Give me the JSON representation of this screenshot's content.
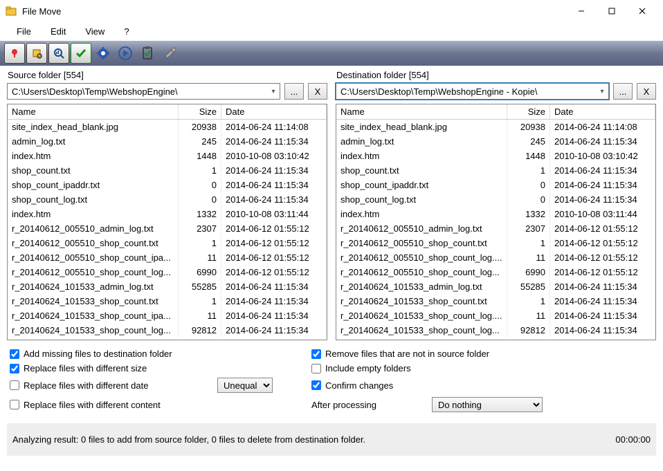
{
  "window": {
    "title": "File Move"
  },
  "menu": {
    "file": "File",
    "edit": "Edit",
    "view": "View",
    "help": "?"
  },
  "source": {
    "label": "Source folder [554]",
    "path": "C:\\Users\\Desktop\\Temp\\WebshopEngine\\",
    "browse": "...",
    "clear": "X"
  },
  "dest": {
    "label": "Destination folder [554]",
    "path": "C:\\Users\\Desktop\\Temp\\WebshopEngine - Kopie\\",
    "browse": "...",
    "clear": "X"
  },
  "columns": {
    "name": "Name",
    "size": "Size",
    "date": "Date"
  },
  "files": [
    {
      "name": "site_index_head_blank.jpg",
      "size": "20938",
      "date": "2014-06-24 11:14:08"
    },
    {
      "name": "admin_log.txt",
      "size": "245",
      "date": "2014-06-24 11:15:34"
    },
    {
      "name": "index.htm",
      "size": "1448",
      "date": "2010-10-08 03:10:42"
    },
    {
      "name": "shop_count.txt",
      "size": "1",
      "date": "2014-06-24 11:15:34"
    },
    {
      "name": "shop_count_ipaddr.txt",
      "size": "0",
      "date": "2014-06-24 11:15:34"
    },
    {
      "name": "shop_count_log.txt",
      "size": "0",
      "date": "2014-06-24 11:15:34"
    },
    {
      "name": "index.htm",
      "size": "1332",
      "date": "2010-10-08 03:11:44"
    },
    {
      "name": "r_20140612_005510_admin_log.txt",
      "size": "2307",
      "date": "2014-06-12 01:55:12"
    },
    {
      "name": "r_20140612_005510_shop_count.txt",
      "size": "1",
      "date": "2014-06-12 01:55:12"
    },
    {
      "name": "r_20140612_005510_shop_count_ipa...",
      "size": "11",
      "date": "2014-06-12 01:55:12"
    },
    {
      "name": "r_20140612_005510_shop_count_log...",
      "size": "6990",
      "date": "2014-06-12 01:55:12"
    },
    {
      "name": "r_20140624_101533_admin_log.txt",
      "size": "55285",
      "date": "2014-06-24 11:15:34"
    },
    {
      "name": "r_20140624_101533_shop_count.txt",
      "size": "1",
      "date": "2014-06-24 11:15:34"
    },
    {
      "name": "r_20140624_101533_shop_count_ipa...",
      "size": "11",
      "date": "2014-06-24 11:15:34"
    },
    {
      "name": "r_20140624_101533_shop_count_log...",
      "size": "92812",
      "date": "2014-06-24 11:15:34"
    }
  ],
  "dest_files_diff": {
    "9": "r_20140612_005510_shop_count_log....",
    "13": "r_20140624_101533_shop_count_log...."
  },
  "options": {
    "add_missing": "Add missing files to destination folder",
    "replace_size": "Replace files with different size",
    "replace_date": "Replace files with different date",
    "replace_content": "Replace files with different content",
    "date_mode": "Unequal",
    "remove_extra": "Remove files that are not in source folder",
    "include_empty": "Include empty folders",
    "confirm": "Confirm changes",
    "after_label": "After processing",
    "after_value": "Do nothing"
  },
  "status": {
    "text": "Analyzing result: 0 files to add from source folder, 0 files to delete from destination folder.",
    "time": "00:00:00"
  }
}
